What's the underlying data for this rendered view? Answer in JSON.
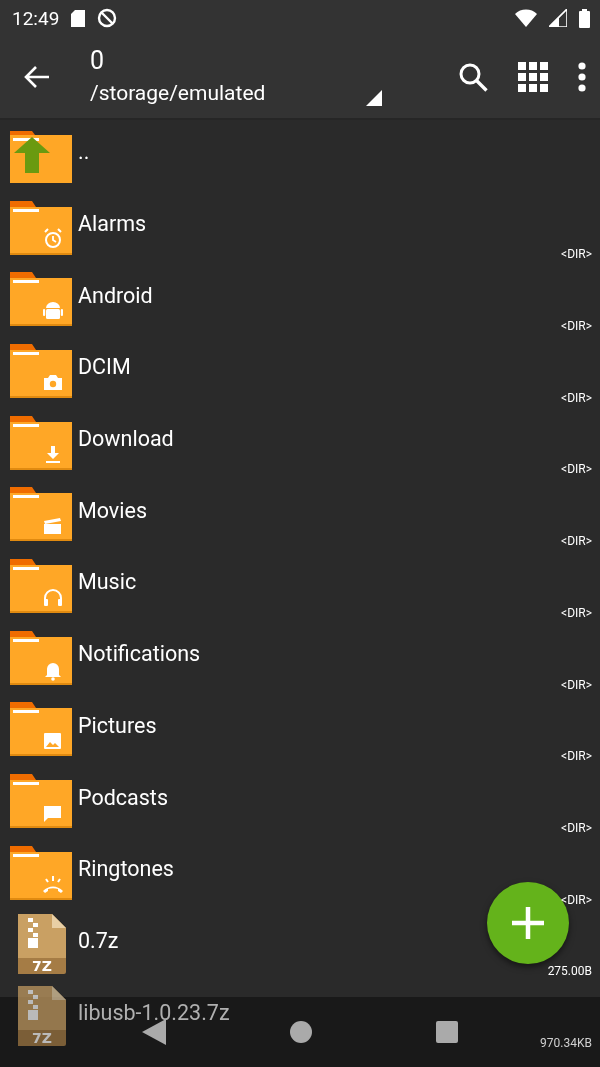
{
  "status_bar": {
    "time": "12:49"
  },
  "toolbar": {
    "title": "0",
    "path": "/storage/emulated"
  },
  "files": [
    {
      "kind": "parent",
      "name": ".."
    },
    {
      "kind": "folder",
      "name": "Alarms",
      "size": "<DIR>"
    },
    {
      "kind": "folder",
      "name": "Android",
      "size": "<DIR>"
    },
    {
      "kind": "folder",
      "name": "DCIM",
      "size": "<DIR>"
    },
    {
      "kind": "folder",
      "name": "Download",
      "size": "<DIR>"
    },
    {
      "kind": "folder",
      "name": "Movies",
      "size": "<DIR>"
    },
    {
      "kind": "folder",
      "name": "Music",
      "size": "<DIR>"
    },
    {
      "kind": "folder",
      "name": "Notifications",
      "size": "<DIR>"
    },
    {
      "kind": "folder",
      "name": "Pictures",
      "size": "<DIR>"
    },
    {
      "kind": "folder",
      "name": "Podcasts",
      "size": "<DIR>"
    },
    {
      "kind": "folder",
      "name": "Ringtones",
      "size": "<DIR>"
    },
    {
      "kind": "archive",
      "name": "0.7z",
      "size": "275.00B",
      "badge": "7Z"
    },
    {
      "kind": "archive",
      "name": "libusb-1.0.23.7z",
      "size": "970.34KB",
      "badge": "7Z"
    }
  ]
}
